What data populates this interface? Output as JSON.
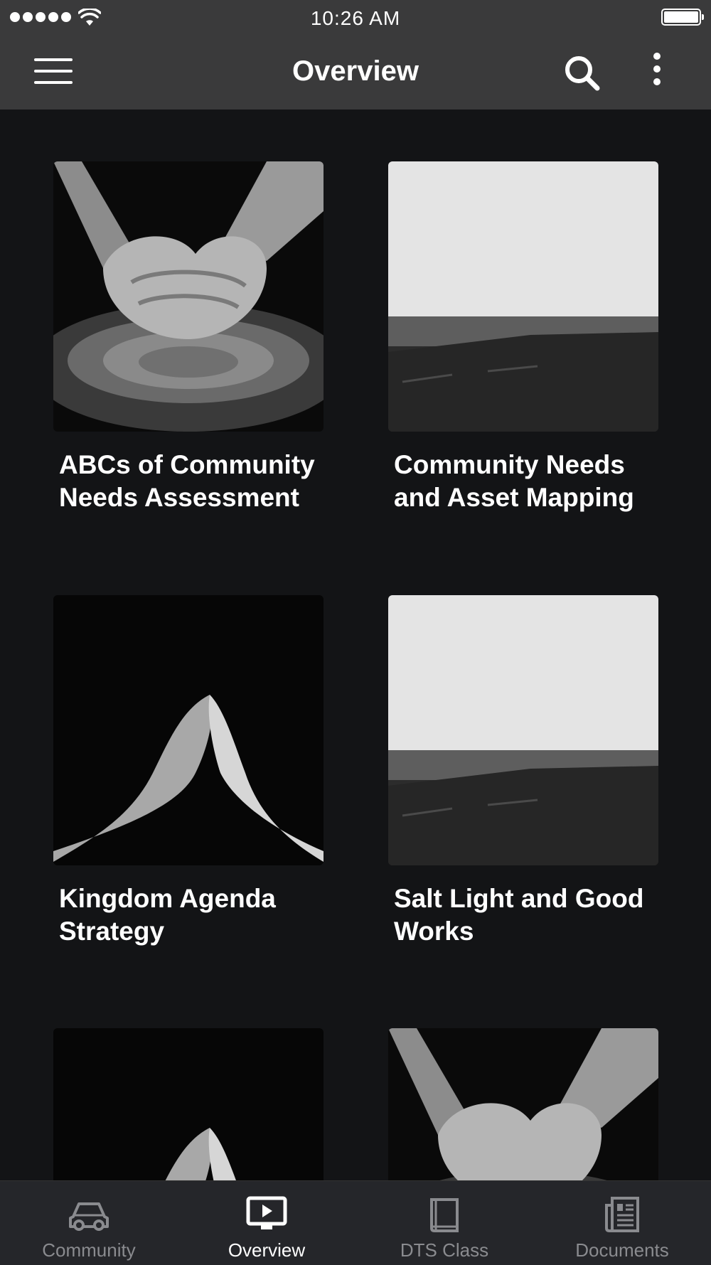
{
  "status_bar": {
    "time": "10:26 AM"
  },
  "header": {
    "title": "Overview"
  },
  "cards": [
    {
      "title": "ABCs of Community Needs Assessment",
      "image": "pottery-hands-photo"
    },
    {
      "title": "Community Needs and Asset Mapping",
      "image": "coastline-photo"
    },
    {
      "title": "Kingdom Agenda Strategy",
      "image": "praying-hands-photo"
    },
    {
      "title": "Salt Light and Good Works",
      "image": "coastline-photo"
    },
    {
      "title": "",
      "image": "praying-hands-photo"
    },
    {
      "title": "",
      "image": "pottery-hands-photo"
    }
  ],
  "tabs": [
    {
      "label": "Community",
      "icon": "car-icon"
    },
    {
      "label": "Overview",
      "icon": "tv-play-icon",
      "active": true
    },
    {
      "label": "DTS Class",
      "icon": "book-icon"
    },
    {
      "label": "Documents",
      "icon": "newspaper-icon"
    }
  ],
  "colors": {
    "background": "#131416",
    "bar": "#3a3a3b",
    "tabbar": "#25262a",
    "inactive": "#8a8b8f"
  }
}
